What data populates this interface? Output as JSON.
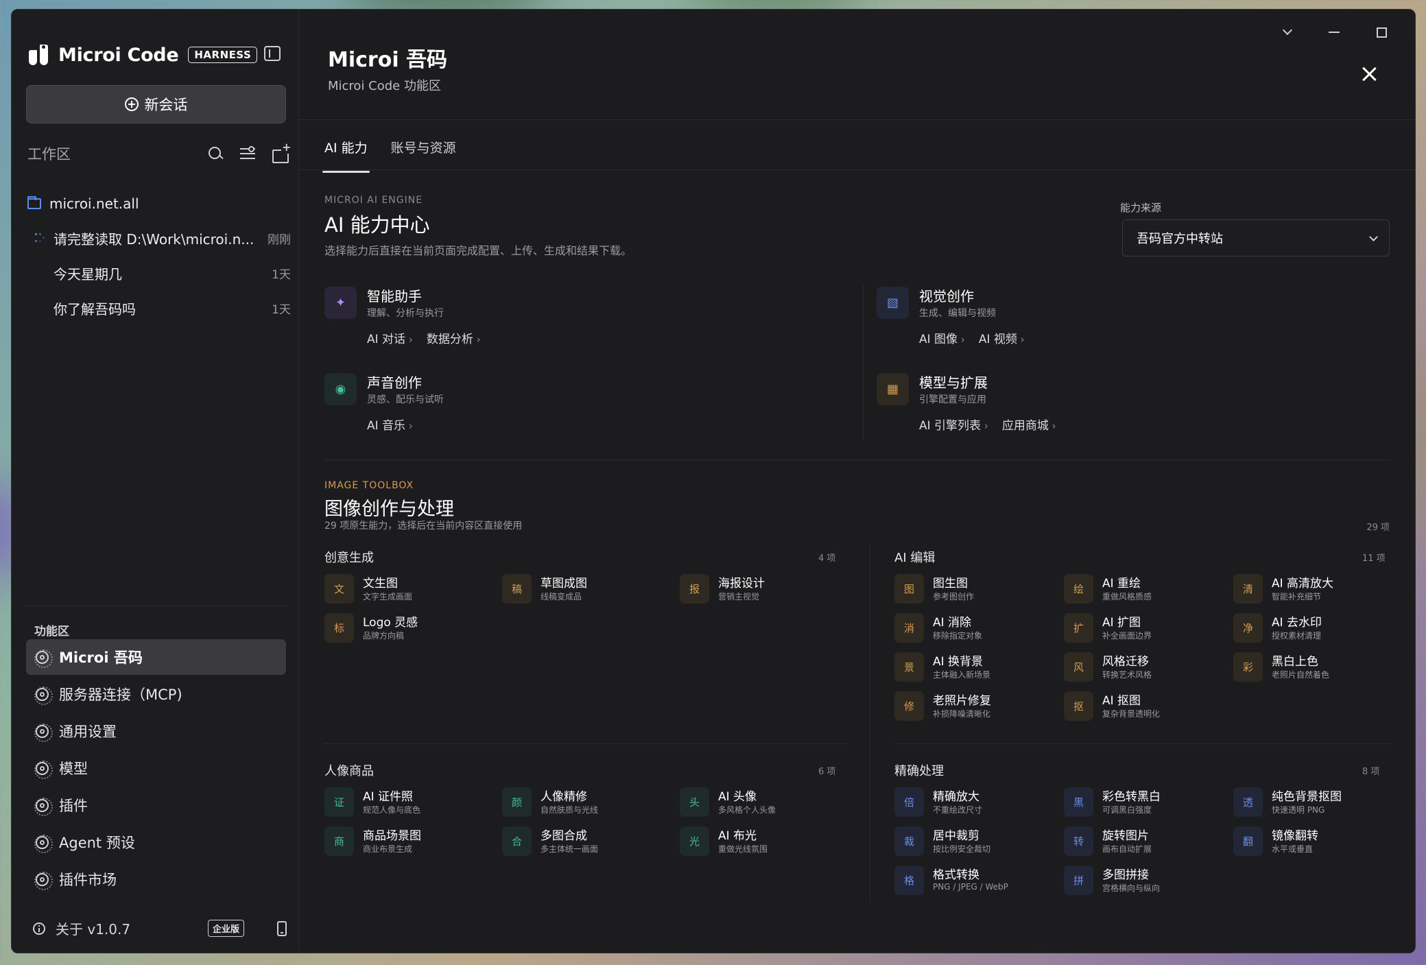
{
  "app": {
    "title": "Microi Code",
    "badge": "HARNESS"
  },
  "sidebar": {
    "new_chat_label": "新会话",
    "workspace_label": "工作区",
    "tree": [
      {
        "label": "microi.net.all",
        "time": ""
      },
      {
        "label": "请完整读取 D:\\Work\\microi.n...",
        "time": "刚刚"
      },
      {
        "label": "今天星期几",
        "time": "1天"
      },
      {
        "label": "你了解吾码吗",
        "time": "1天"
      }
    ],
    "function_area_title": "功能区",
    "function_items": [
      {
        "label": "Microi 吾码"
      },
      {
        "label": "服务器连接（MCP)"
      },
      {
        "label": "通用设置"
      },
      {
        "label": "模型"
      },
      {
        "label": "插件"
      },
      {
        "label": "Agent 预设"
      },
      {
        "label": "插件市场"
      }
    ],
    "about_label": "关于 v1.0.7",
    "edition_badge": "企业版"
  },
  "panel": {
    "title": "Microi 吾码",
    "subtitle": "Microi Code 功能区",
    "tabs": [
      {
        "label": "AI 能力"
      },
      {
        "label": "账号与资源"
      }
    ]
  },
  "ai_center": {
    "eyebrow": "MICROI AI ENGINE",
    "title": "AI 能力中心",
    "desc": "选择能力后直接在当前页面完成配置、上传、生成和结果下载。",
    "source_label": "能力来源",
    "source_value": "吾码官方中转站",
    "cards": [
      {
        "title": "智能助手",
        "sub": "理解、分析与执行",
        "icon": "✦",
        "links": [
          "AI 对话",
          "数据分析"
        ]
      },
      {
        "title": "视觉创作",
        "sub": "生成、编辑与视频",
        "icon": "▧",
        "links": [
          "AI 图像",
          "AI 视频"
        ]
      },
      {
        "title": "声音创作",
        "sub": "灵感、配乐与试听",
        "icon": "◉",
        "links": [
          "AI 音乐"
        ]
      },
      {
        "title": "模型与扩展",
        "sub": "引擎配置与应用",
        "icon": "▦",
        "links": [
          "AI 引擎列表",
          "应用商城"
        ]
      }
    ]
  },
  "toolbox": {
    "eyebrow": "IMAGE TOOLBOX",
    "title": "图像创作与处理",
    "desc": "29 项原生能力，选择后在当前内容区直接使用",
    "count": "29 项",
    "groups": [
      {
        "title": "创意生成",
        "count": "4 项",
        "tools": [
          {
            "icon": "文",
            "title": "文生图",
            "sub": "文字生成画面"
          },
          {
            "icon": "稿",
            "title": "草图成图",
            "sub": "线稿变成品"
          },
          {
            "icon": "报",
            "title": "海报设计",
            "sub": "营销主视觉"
          },
          {
            "icon": "标",
            "title": "Logo 灵感",
            "sub": "品牌方向稿"
          }
        ]
      },
      {
        "title": "AI 编辑",
        "count": "11 项",
        "tools": [
          {
            "icon": "图",
            "title": "图生图",
            "sub": "参考图创作"
          },
          {
            "icon": "绘",
            "title": "AI 重绘",
            "sub": "重做风格质感"
          },
          {
            "icon": "清",
            "title": "AI 高清放大",
            "sub": "智能补充细节"
          },
          {
            "icon": "消",
            "title": "AI 消除",
            "sub": "移除指定对象"
          },
          {
            "icon": "扩",
            "title": "AI 扩图",
            "sub": "补全画面边界"
          },
          {
            "icon": "净",
            "title": "AI 去水印",
            "sub": "授权素材清理"
          },
          {
            "icon": "景",
            "title": "AI 换背景",
            "sub": "主体融入新场景"
          },
          {
            "icon": "风",
            "title": "风格迁移",
            "sub": "转换艺术风格"
          },
          {
            "icon": "彩",
            "title": "黑白上色",
            "sub": "老照片自然着色"
          },
          {
            "icon": "修",
            "title": "老照片修复",
            "sub": "补损降噪清晰化"
          },
          {
            "icon": "抠",
            "title": "AI 抠图",
            "sub": "复杂背景透明化"
          }
        ]
      },
      {
        "title": "人像商品",
        "count": "6 项",
        "tools": [
          {
            "icon": "证",
            "title": "AI 证件照",
            "sub": "规范人像与底色"
          },
          {
            "icon": "颜",
            "title": "人像精修",
            "sub": "自然肤质与光线"
          },
          {
            "icon": "头",
            "title": "AI 头像",
            "sub": "多风格个人头像"
          },
          {
            "icon": "商",
            "title": "商品场景图",
            "sub": "商业布景生成"
          },
          {
            "icon": "合",
            "title": "多图合成",
            "sub": "多主体统一画面"
          },
          {
            "icon": "光",
            "title": "AI 布光",
            "sub": "重做光线氛围"
          }
        ]
      },
      {
        "title": "精确处理",
        "count": "8 项",
        "tools": [
          {
            "icon": "倍",
            "title": "精确放大",
            "sub": "不重绘改尺寸"
          },
          {
            "icon": "黑",
            "title": "彩色转黑白",
            "sub": "可调黑白强度"
          },
          {
            "icon": "透",
            "title": "纯色背景抠图",
            "sub": "快速透明 PNG"
          },
          {
            "icon": "裁",
            "title": "居中裁剪",
            "sub": "按比例安全裁切"
          },
          {
            "icon": "转",
            "title": "旋转图片",
            "sub": "画布自动扩展"
          },
          {
            "icon": "翻",
            "title": "镜像翻转",
            "sub": "水平或垂直"
          },
          {
            "icon": "格",
            "title": "格式转换",
            "sub": "PNG / JPEG / WebP"
          },
          {
            "icon": "拼",
            "title": "多图拼接",
            "sub": "宫格横向与纵向"
          }
        ]
      }
    ]
  }
}
